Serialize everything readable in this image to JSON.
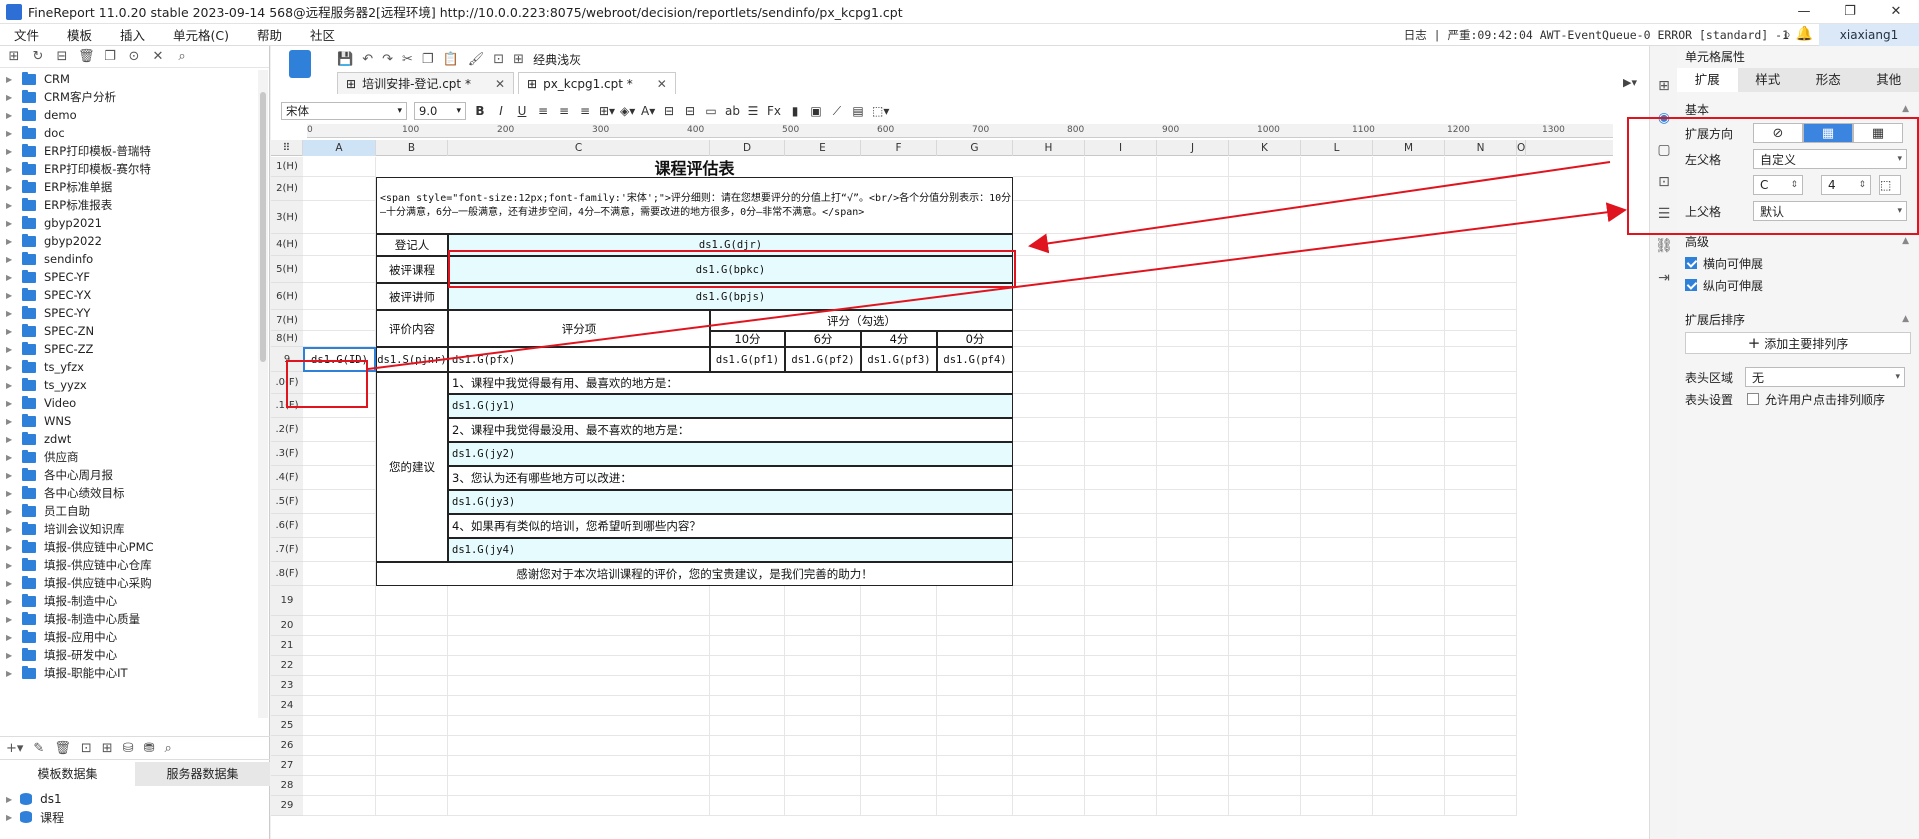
{
  "window": {
    "title": "FineReport 11.0.20 stable 2023-09-14 568@远程服务器2[远程环境]    http://10.0.0.223:8075/webroot/decision/reportlets/sendinfo/px_kcpg1.cpt",
    "controls": [
      "—",
      "❐",
      "✕"
    ]
  },
  "menu": {
    "items": [
      "文件",
      "模板",
      "插入",
      "单元格(C)",
      "帮助",
      "社区"
    ],
    "log": "日志 | 严重:09:42:04 AWT-EventQueue-0 ERROR [standard] -1",
    "user": "xiaxiang1"
  },
  "tree": {
    "items": [
      "CRM",
      "CRM客户分析",
      "demo",
      "doc",
      "ERP打印模板-普瑞特",
      "ERP打印模板-赛尔特",
      "ERP标准单据",
      "ERP标准报表",
      "gbyp2021",
      "gbyp2022",
      "sendinfo",
      "SPEC-YF",
      "SPEC-YX",
      "SPEC-YY",
      "SPEC-ZN",
      "SPEC-ZZ",
      "ts_yfzx",
      "ts_yyzx",
      "Video",
      "WNS",
      "zdwt",
      "供应商",
      "各中心周月报",
      "各中心绩效目标",
      "员工自助",
      "培训会议知识库",
      "填报-供应链中心PMC",
      "填报-供应链中心仓库",
      "填报-供应链中心采购",
      "填报-制造中心",
      "填报-制造中心质量",
      "填报-应用中心",
      "填报-研发中心",
      "填报-职能中心IT"
    ]
  },
  "datasets": {
    "tabs": [
      "模板数据集",
      "服务器数据集"
    ],
    "items": [
      "ds1",
      "课程"
    ]
  },
  "toolbar": {
    "classic_label": "经典浅灰"
  },
  "doc_tabs": [
    {
      "label": "培训安排-登记.cpt *"
    },
    {
      "label": "px_kcpg1.cpt *"
    }
  ],
  "format": {
    "font": "宋体",
    "size": "9.0"
  },
  "sheet": {
    "columns": [
      "A",
      "B",
      "C",
      "D",
      "E",
      "F",
      "G",
      "H",
      "I",
      "J",
      "K",
      "L",
      "M",
      "N",
      "O"
    ],
    "rows": [
      "1(H)",
      "2(H)",
      "3(H)",
      "4(H)",
      "5(H)",
      "6(H)",
      "7(H)",
      "8(H)",
      "9",
      ".0(F)",
      ".1(F)",
      ".2(F)",
      ".3(F)",
      ".4(F)",
      ".5(F)",
      ".6(F)",
      ".7(F)",
      ".8(F)",
      "19",
      "20",
      "21",
      "22",
      "23",
      "24",
      "25",
      "26",
      "27",
      "28",
      "29"
    ],
    "ruler": [
      "0",
      "100",
      "200",
      "300",
      "400",
      "500",
      "600",
      "700",
      "800",
      "900",
      "1000",
      "1100",
      "1200",
      "1300"
    ],
    "title": "课程评估表",
    "intro": "<span style=\"font-size:12px;font-family:'宋体';\">评分细则：请在您想要评分的分值上打“√”。<br/>各个分值分别表示：10分—十分满意，6分—一般满意，还有进步空间，4分—不满意，需要改进的地方很多，0分—非常不满意。</span>",
    "registrant_label": "登记人",
    "registrant_value": "ds1.G(djr)",
    "course_label": "被评课程",
    "course_value": "ds1.G(bpkc)",
    "teacher_label": "被评讲师",
    "teacher_value": "ds1.G(bpjs)",
    "content_label": "评价内容",
    "item_label": "评分项",
    "score_label": "评分（勾选）",
    "scores": [
      "10分",
      "6分",
      "4分",
      "0分"
    ],
    "row9": {
      "a": "ds1.G(ID)",
      "b": "ds1.S(pjnr)",
      "c": "ds1.G(pfx)",
      "d": "ds1.G(pf1)",
      "e": "ds1.G(pf2)",
      "f": "ds1.G(pf3)",
      "g": "ds1.G(pf4)"
    },
    "suggest_label": "您的建议",
    "q1": "1、课程中我觉得最有用、最喜欢的地方是：",
    "a1": "ds1.G(jy1)",
    "q2": "2、课程中我觉得最没用、最不喜欢的地方是：",
    "a2": "ds1.G(jy2)",
    "q3": "3、您认为还有哪些地方可以改进：",
    "a3": "ds1.G(jy3)",
    "q4": "4、如果再有类似的培训，您希望听到哪些内容？",
    "a4": "ds1.G(jy4)",
    "thanks": "感谢您对于本次培训课程的评价，您的宝贵建议，是我们完善的助力！"
  },
  "props": {
    "header": "单元格属性",
    "tabs": [
      "扩展",
      "样式",
      "形态",
      "其他"
    ],
    "basic": "基本",
    "expand_dir": "扩展方向",
    "left_parent": "左父格",
    "left_parent_value": "自定义",
    "left_parent_col": "C",
    "left_parent_row": "4",
    "top_parent": "上父格",
    "top_parent_value": "默认",
    "advanced": "高级",
    "h_expand": "横向可伸展",
    "v_expand": "纵向可伸展",
    "sort": "扩展后排序",
    "add_sort": "添加主要排列序",
    "header_area": "表头区域",
    "header_area_value": "无",
    "header_setting": "表头设置",
    "allow_sort": "允许用户点击排列顺序"
  },
  "colors": {
    "accent": "#2f80d8",
    "annotation": "#e0141e",
    "cell_fill": "#e6fbfd"
  }
}
